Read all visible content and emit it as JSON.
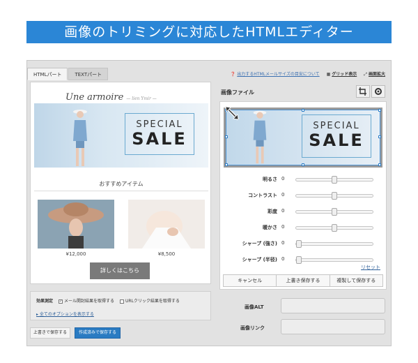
{
  "banner": {
    "title": "画像のトリミングに対応したHTMLエディター"
  },
  "tabs": [
    {
      "label": "HTMLパート"
    },
    {
      "label": "TEXTパート"
    }
  ],
  "toplinks": {
    "help": "出力するHTMLメールサイズの目安について",
    "grid": "グリッド表示",
    "zoom": "画面拡大"
  },
  "preview": {
    "brand": "Une armoire",
    "brand_sub": "— lien Ymir —",
    "hero": {
      "line1": "SPECIAL",
      "line2": "SALE"
    },
    "recommend_title": "おすすめアイテム",
    "products": [
      {
        "price": "¥12,000"
      },
      {
        "price": "¥8,500"
      }
    ],
    "details_button": "詳しくはこちら"
  },
  "measure": {
    "label": "効果測定",
    "option1": "メール開封結果を取得する",
    "option2": "URLクリック結果を取得する",
    "show_all": "全てのオプションを表示する"
  },
  "footer": {
    "save_over": "上書きで保存する",
    "save_ask": "作成済みで保存する"
  },
  "image_panel": {
    "title": "画像ファイル",
    "preview": {
      "line1": "SPECIAL",
      "line2": "SALE"
    },
    "sliders": [
      {
        "label": "明るさ",
        "value": "0",
        "pos": 0.5
      },
      {
        "label": "コントラスト",
        "value": "0",
        "pos": 0.5
      },
      {
        "label": "彩度",
        "value": "0",
        "pos": 0.5
      },
      {
        "label": "暖かさ",
        "value": "0",
        "pos": 0.5
      },
      {
        "label": "シャープ (強さ)",
        "value": "0",
        "pos": 0.0
      },
      {
        "label": "シャープ (半径)",
        "value": "0",
        "pos": 0.0
      }
    ],
    "reset": "リセット",
    "buttons": {
      "cancel": "キャンセル",
      "overwrite": "上書き保存する",
      "duplicate": "複製して保存する"
    }
  },
  "fields": {
    "alt_label": "画像ALT",
    "link_label": "画像リンク"
  }
}
